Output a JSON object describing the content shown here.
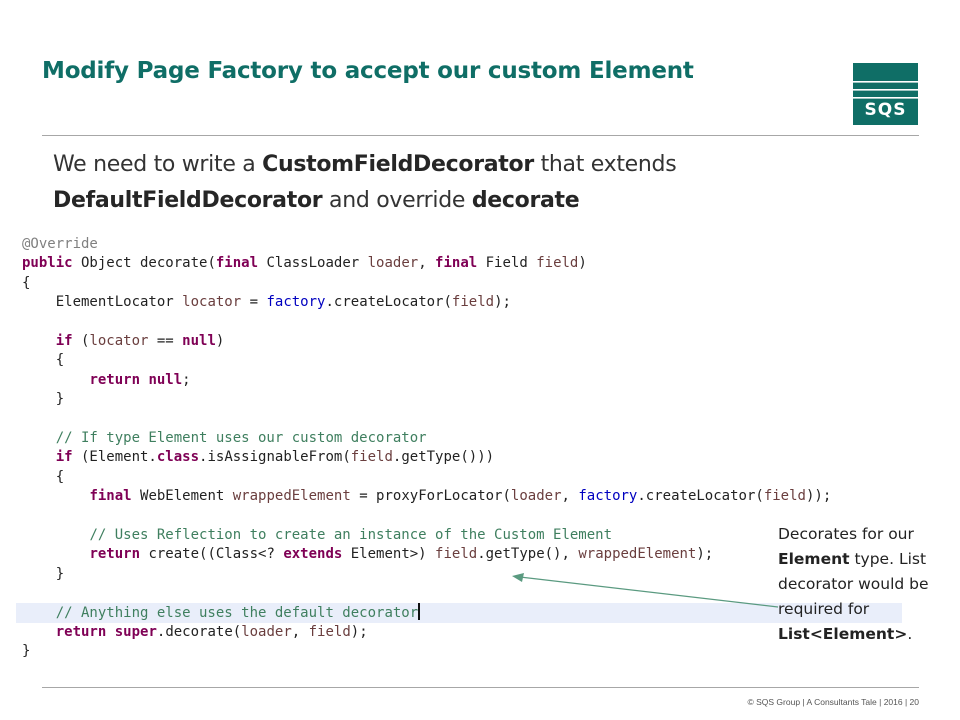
{
  "slide": {
    "title": "Modify Page Factory to accept our custom Element",
    "logo_text": "SQS",
    "subtitle": {
      "t1": "We need to write a ",
      "b1": "CustomFieldDecorator",
      "t2": " that extends",
      "b2": "DefaultFieldDecorator",
      "t3": " and override ",
      "b3": "decorate"
    },
    "code_lines": [
      [
        {
          "c": "annot",
          "t": "@Override"
        }
      ],
      [
        {
          "c": "kw",
          "t": "public"
        },
        {
          "t": " Object decorate("
        },
        {
          "c": "kw",
          "t": "final"
        },
        {
          "t": " ClassLoader "
        },
        {
          "c": "var",
          "t": "loader"
        },
        {
          "t": ", "
        },
        {
          "c": "kw",
          "t": "final"
        },
        {
          "t": " Field "
        },
        {
          "c": "var",
          "t": "field"
        },
        {
          "t": ")"
        }
      ],
      [
        {
          "t": "{"
        }
      ],
      [
        {
          "t": "    ElementLocator "
        },
        {
          "c": "var",
          "t": "locator"
        },
        {
          "t": " = "
        },
        {
          "c": "fld",
          "t": "factory"
        },
        {
          "t": ".createLocator("
        },
        {
          "c": "var",
          "t": "field"
        },
        {
          "t": ");"
        }
      ],
      [
        {
          "t": ""
        }
      ],
      [
        {
          "t": "    "
        },
        {
          "c": "kw",
          "t": "if"
        },
        {
          "t": " ("
        },
        {
          "c": "var",
          "t": "locator"
        },
        {
          "t": " == "
        },
        {
          "c": "kw",
          "t": "null"
        },
        {
          "t": ")"
        }
      ],
      [
        {
          "t": "    {"
        }
      ],
      [
        {
          "t": "        "
        },
        {
          "c": "kw",
          "t": "return"
        },
        {
          "t": " "
        },
        {
          "c": "kw",
          "t": "null"
        },
        {
          "t": ";"
        }
      ],
      [
        {
          "t": "    }"
        }
      ],
      [
        {
          "t": ""
        }
      ],
      [
        {
          "t": "    "
        },
        {
          "c": "cmt",
          "t": "// If type Element uses our custom decorator"
        }
      ],
      [
        {
          "t": "    "
        },
        {
          "c": "kw",
          "t": "if"
        },
        {
          "t": " (Element."
        },
        {
          "c": "kw",
          "t": "class"
        },
        {
          "t": ".isAssignableFrom("
        },
        {
          "c": "var",
          "t": "field"
        },
        {
          "t": ".getType()))"
        }
      ],
      [
        {
          "t": "    {"
        }
      ],
      [
        {
          "t": "        "
        },
        {
          "c": "kw",
          "t": "final"
        },
        {
          "t": " WebElement "
        },
        {
          "c": "var",
          "t": "wrappedElement"
        },
        {
          "t": " = proxyForLocator("
        },
        {
          "c": "var",
          "t": "loader"
        },
        {
          "t": ", "
        },
        {
          "c": "fld",
          "t": "factory"
        },
        {
          "t": ".createLocator("
        },
        {
          "c": "var",
          "t": "field"
        },
        {
          "t": "));"
        }
      ],
      [
        {
          "t": ""
        }
      ],
      [
        {
          "t": "        "
        },
        {
          "c": "cmt",
          "t": "// Uses Reflection to create an instance of the Custom Element"
        }
      ],
      [
        {
          "t": "        "
        },
        {
          "c": "kw",
          "t": "return"
        },
        {
          "t": " create((Class<? "
        },
        {
          "c": "kw",
          "t": "extends"
        },
        {
          "t": " Element>) "
        },
        {
          "c": "var",
          "t": "field"
        },
        {
          "t": ".getType(), "
        },
        {
          "c": "var",
          "t": "wrappedElement"
        },
        {
          "t": ");"
        }
      ],
      [
        {
          "t": "    }"
        }
      ],
      [
        {
          "t": ""
        }
      ],
      [
        {
          "t": "    "
        },
        {
          "c": "cmt",
          "t": "// Anything else uses the default decorator"
        },
        {
          "c": "caret",
          "t": ""
        }
      ],
      [
        {
          "t": "    "
        },
        {
          "c": "kw",
          "t": "return"
        },
        {
          "t": " "
        },
        {
          "c": "kw",
          "t": "super"
        },
        {
          "t": ".decorate("
        },
        {
          "c": "var",
          "t": "loader"
        },
        {
          "t": ", "
        },
        {
          "c": "var",
          "t": "field"
        },
        {
          "t": ");"
        }
      ],
      [
        {
          "t": "}"
        }
      ]
    ],
    "note": {
      "l1": "Decorates for our",
      "l2b": "Element",
      "l2": " type. List",
      "l3": "decorator would be",
      "l4": "required for",
      "l5b": "List<Element>",
      "l5": "."
    },
    "footer": "© SQS Group  |  A Consultants Tale  |  2016  |  20",
    "colors": {
      "title": "#0f6e66",
      "logo": "#0f6e66",
      "keyword": "#7f0055",
      "comment": "#3f7f5f",
      "field": "#0000c0",
      "variable": "#6a3e3e",
      "annotation": "#808080",
      "arrow": "#5a9a80",
      "highlight": "#e9eefa"
    }
  }
}
